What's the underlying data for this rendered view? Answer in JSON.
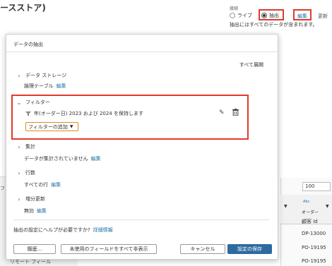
{
  "background": {
    "title": "ースストア)",
    "connection_label": "接続",
    "live_label": "ライブ",
    "extract_label": "抽出",
    "edit_link": "編集",
    "update_link": "更新",
    "extract_note": "抽出にはすべてのデータが含まれます。",
    "left_letter": "フ",
    "bottom_left_text": "リモート フィール",
    "rows_input_value": "100",
    "grid": {
      "type_icon": "Abc",
      "order_label": "オーダー",
      "column_header": "顧客 Id",
      "rows": [
        "DP-13000",
        "PO-19195",
        "PO-19195"
      ]
    }
  },
  "dialog": {
    "title": "データの抽出",
    "expand_all": "すべて展開",
    "sections": {
      "data_storage": {
        "label": "データ ストレージ",
        "value": "論理テーブル",
        "edit": "編集"
      },
      "filter": {
        "label": "フィルター",
        "item": "年(オーダー日)  2023 および 2024 を保持します",
        "add_button": "フィルターの追加"
      },
      "aggregation": {
        "label": "集計",
        "value": "データが集計されていません",
        "edit": "編集"
      },
      "rows": {
        "label": "行数",
        "value": "すべての行",
        "edit": "編集"
      },
      "incremental": {
        "label": "増分更新",
        "value": "無効",
        "edit": "編集"
      }
    },
    "help_text": "抽出の設定にヘルプが必要ですか?",
    "help_link": "詳細情報",
    "buttons": {
      "history": "履歴...",
      "hide_unused": "未使用のフィールドをすべて非表示",
      "cancel": "キャンセル",
      "save": "設定の保存"
    }
  },
  "icons": {
    "chevron_right": "chevron-right-icon",
    "chevron_down": "chevron-down-icon",
    "pencil": "pencil-icon",
    "trash": "trash-icon",
    "filter_pill": "filter-pill-icon"
  },
  "colors": {
    "highlight": "#e03a2d",
    "link": "#1f6fa8",
    "primary_button": "#2d6aa0",
    "add_filter_border": "#e08a1a"
  }
}
